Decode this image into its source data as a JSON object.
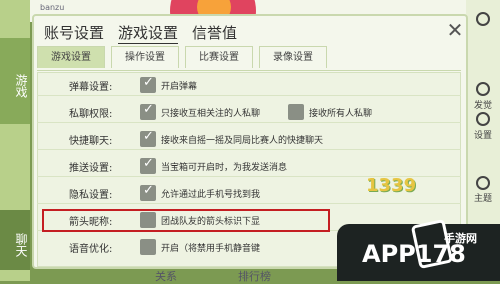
{
  "background": {
    "username": "banzu",
    "left_tabs": [
      "游戏",
      "聊天"
    ],
    "right_labels": [
      "发觉",
      "设置",
      "主题"
    ],
    "bottom_tabs": [
      "关系",
      "排行榜"
    ]
  },
  "dialog": {
    "tabs": [
      {
        "label": "账号设置"
      },
      {
        "label": "游戏设置"
      },
      {
        "label": "信誉值"
      }
    ],
    "subtabs": [
      {
        "label": "游戏设置"
      },
      {
        "label": "操作设置"
      },
      {
        "label": "比赛设置"
      },
      {
        "label": "录像设置"
      }
    ],
    "rows": [
      {
        "label": "弹幕设置:",
        "options": [
          "开启弹幕"
        ]
      },
      {
        "label": "私聊权限:",
        "options": [
          "只接收互相关注的人私聊",
          "接收所有人私聊"
        ]
      },
      {
        "label": "快捷聊天:",
        "options": [
          "接收来自摇一摇及同局比赛人的快捷聊天"
        ]
      },
      {
        "label": "推送设置:",
        "options": [
          "当宝箱可开启时，为我发送消息"
        ]
      },
      {
        "label": "隐私设置:",
        "options": [
          "允许通过此手机号找到我"
        ]
      },
      {
        "label": "箭头昵称:",
        "options": [
          "团战队友的箭头标识下显"
        ]
      },
      {
        "label": "语音优化:",
        "options": [
          "开启（将禁用手机静音键"
        ]
      }
    ]
  },
  "watermark": {
    "brand": "APP178",
    "site": "手游网",
    "bubble": "1339"
  },
  "colors": {
    "accent": "#8fbf45",
    "highlight": "#c41e22"
  }
}
